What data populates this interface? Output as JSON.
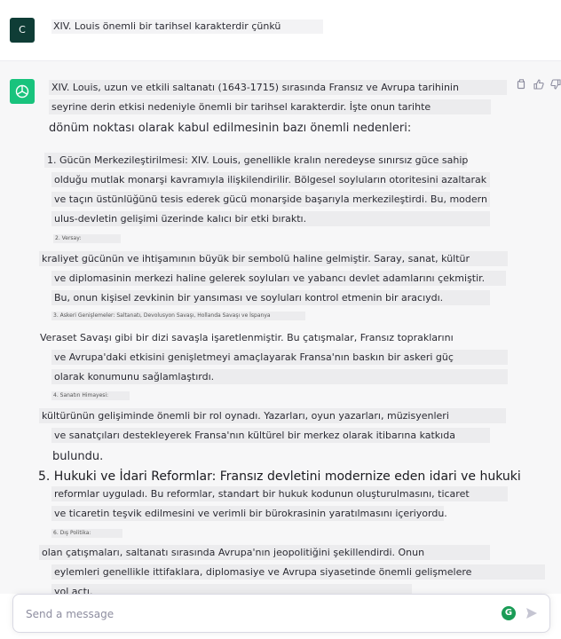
{
  "user": {
    "avatar_letter": "C",
    "message": "XIV. Louis önemli bir tarihsel karakterdir çünkü"
  },
  "assistant": {
    "lines": [
      "XIV. Louis, uzun ve etkili saltanatı (1643-1715) sırasında Fransız ve Avrupa tarihinin",
      "seyrine derin etkisi nedeniyle önemli bir tarihsel karakterdir. İşte onun tarihte",
      "dönüm noktası olarak kabul edilmesinin bazı önemli nedenleri:",
      "1. Gücün Merkezileştirilmesi: XIV. Louis, genellikle kralın neredeyse sınırsız güce sahip",
      "olduğu mutlak monarşi kavramıyla ilişkilendirilir. Bölgesel soyluların otoritesini azaltarak",
      "ve taçın üstünlüğünü tesis ederek gücü monarşide başarıyla merkezileştirdi. Bu, modern",
      "ulus-devletin gelişimi üzerinde kalıcı bir etki bıraktı.",
      "2. Versay:",
      "kraliyet gücünün ve ihtişamının büyük bir sembolü haline gelmiştir. Saray, sanat, kültür",
      "ve diplomasinin merkezi haline gelerek soyluları ve yabancı devlet adamlarını çekmiştir.",
      "Bu, onun kişisel zevkinin bir yansıması ve soyluları kontrol etmenin bir aracıydı.",
      "3. Askeri Genişlemeler: Saltanatı, Devolusyon Savaşı, Hollanda Savaşı ve İspanya",
      "Veraset Savaşı gibi bir dizi savaşla işaretlenmiştir. Bu çatışmalar, Fransız topraklarını",
      "ve Avrupa'daki etkisini genişletmeyi amaçlayarak Fransa'nın baskın bir askeri güç",
      "olarak konumunu sağlamlaştırdı.",
      "4. Sanatın Himayesi:",
      "kültürünün gelişiminde önemli bir rol oynadı. Yazarları, oyun yazarları, müzisyenleri",
      "ve sanatçıları destekleyerek Fransa'nın kültürel bir merkez olarak itibarına katkıda",
      "bulundu.",
      "5. Hukuki ve İdari Reformlar: Fransız devletini modernize eden idari ve hukuki",
      "reformlar uyguladı. Bu reformlar, standart bir hukuk kodunun oluşturulmasını, ticaret",
      "ve ticaretin teşvik edilmesini ve verimli bir bürokrasinin yaratılmasını içeriyordu.",
      "6. Dış Politika:",
      "olan çatışmaları, saltanatı sırasında Avrupa'nın jeopolitiğini şekillendirdi. Onun",
      "eylemleri genellikle ittifaklara, diplomasiye ve Avrupa siyasetinde önemli gelişmelere",
      "yol açtı."
    ]
  },
  "composer": {
    "placeholder": "Send a message",
    "grammarly_letter": "G"
  },
  "icons": {
    "copy": "copy-icon",
    "thumbs_up": "thumbs-up-icon",
    "thumbs_down": "thumbs-down-icon",
    "send": "send-icon"
  },
  "colors": {
    "user_avatar": "#0f3d36",
    "bot_avatar": "#19c37d",
    "assistant_bg": "#f7f7f8"
  }
}
